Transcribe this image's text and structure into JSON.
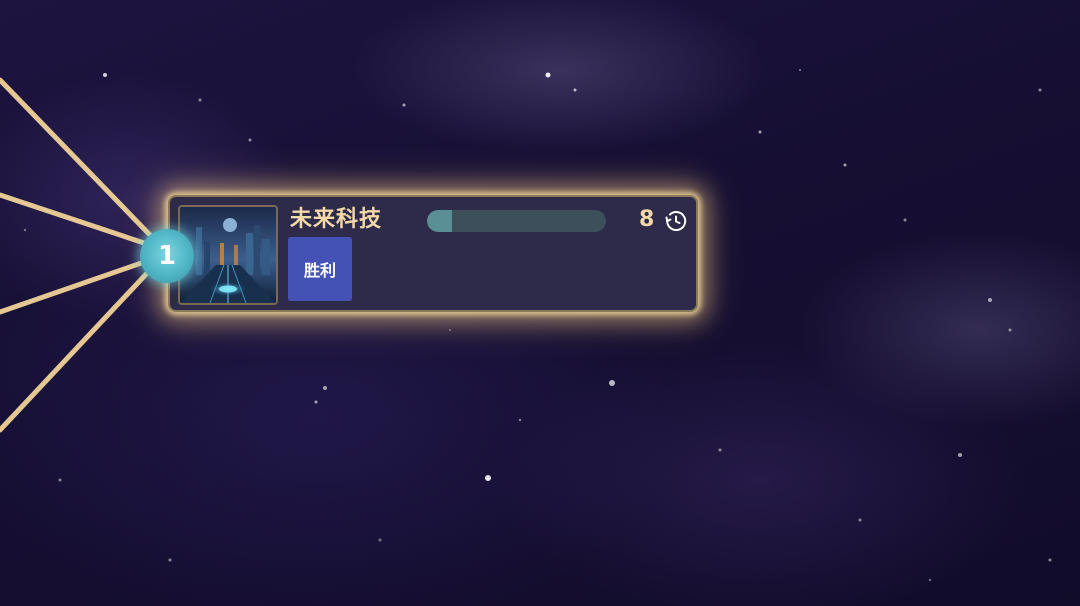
{
  "node": {
    "index": "1",
    "title": "未来科技",
    "progress": 0.14,
    "turns": "8",
    "result_label": "胜利",
    "thumbnail": "futuristic-city-image"
  },
  "colors": {
    "glow": "#ffe3a0",
    "card_bg": "#2d2a4a",
    "title_gold": "#f3d9a8",
    "result_blue": "#4452b6",
    "badge_teal": "#4fb4c4",
    "progress_track": "#3e4f5c",
    "progress_fill": "#5a8f95"
  },
  "icons": {
    "clock": "clock-rewind-icon"
  }
}
